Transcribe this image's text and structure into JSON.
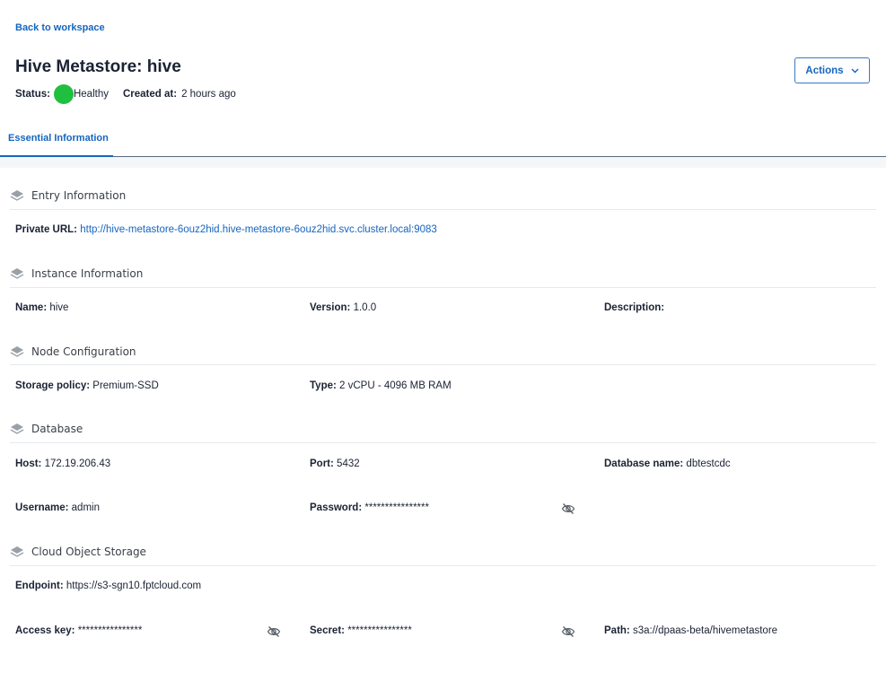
{
  "nav": {
    "back_label": "Back to workspace"
  },
  "header": {
    "title": "Hive Metastore: hive",
    "status_label": "Status:",
    "status_value": "Healthy",
    "status_color": "#1fbf3f",
    "created_label": "Created at:",
    "created_value": "2 hours ago",
    "actions_label": "Actions"
  },
  "tabs": [
    {
      "label": "Essential Information",
      "active": true
    }
  ],
  "sections": {
    "entry": {
      "title": "Entry Information",
      "private_url_label": "Private URL:",
      "private_url_value": "http://hive-metastore-6ouz2hid.hive-metastore-6ouz2hid.svc.cluster.local:9083"
    },
    "instance": {
      "title": "Instance Information",
      "name_label": "Name:",
      "name_value": "hive",
      "version_label": "Version:",
      "version_value": "1.0.0",
      "description_label": "Description:",
      "description_value": ""
    },
    "node": {
      "title": "Node Configuration",
      "storage_label": "Storage policy:",
      "storage_value": "Premium-SSD",
      "type_label": "Type:",
      "type_value": "2 vCPU - 4096 MB RAM"
    },
    "database": {
      "title": "Database",
      "host_label": "Host:",
      "host_value": "172.19.206.43",
      "port_label": "Port:",
      "port_value": "5432",
      "dbname_label": "Database name:",
      "dbname_value": "dbtestcdc",
      "username_label": "Username:",
      "username_value": "admin",
      "password_label": "Password:",
      "password_value": "****************"
    },
    "storage": {
      "title": "Cloud Object Storage",
      "endpoint_label": "Endpoint:",
      "endpoint_value": "https://s3-sgn10.fptcloud.com",
      "access_label": "Access key:",
      "access_value": "****************",
      "secret_label": "Secret:",
      "secret_value": "****************",
      "path_label": "Path:",
      "path_value": "s3a://dpaas-beta/hivemetastore"
    }
  },
  "icons": {
    "section": "layers-icon",
    "reveal": "eye-off-icon",
    "dropdown": "chevron-down-icon"
  }
}
